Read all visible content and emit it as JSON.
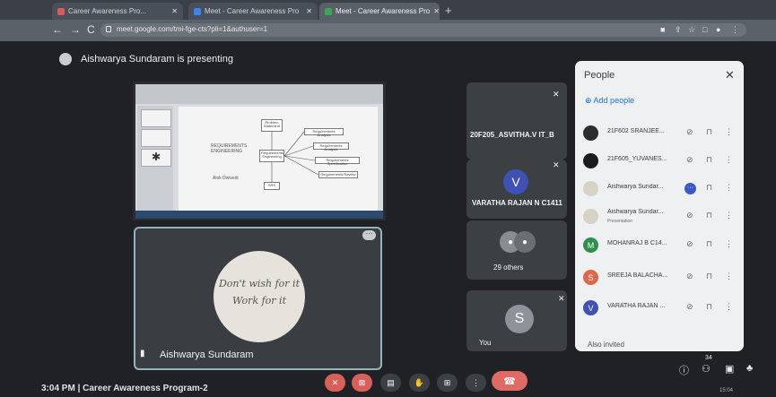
{
  "browser": {
    "tabs": [
      {
        "label": "Career Awareness Pro...",
        "icon_color": "#e0585b"
      },
      {
        "label": "Meet - Career Awareness Pro",
        "icon_color": "#3b82f6"
      },
      {
        "label": "Meet - Career Awareness Pro",
        "icon_color": "#34a853"
      }
    ],
    "url": "meet.google.com/tmi-fge-cts?pli=1&authuser=1"
  },
  "meet": {
    "presenting_text": "Aishwarya Sundaram is presenting",
    "slide": {
      "title_text": "REQUIREMENTS ENGINEERING",
      "subtitle_text": "Alok Dwivedi",
      "boxes": [
        "Problem Statement",
        "Requirements Engineering",
        "SRS",
        "Requirements Analysis",
        "Requirements Analysis",
        "Requirements Specification",
        "Requirements Review"
      ]
    },
    "self_tile": {
      "name": "Aishwarya Sundaram",
      "quote_line1": "Don't wish for it",
      "quote_line2": "Work for it"
    },
    "tiles": [
      {
        "name": "20F205_ASVITHA.V IT_B"
      },
      {
        "name": "VARATHA RAJAN N C1411",
        "initial": "V",
        "color": "#3f51b5"
      },
      {
        "name": "29 others"
      },
      {
        "name": "You",
        "initial": "S",
        "color": "#8e9399"
      }
    ],
    "people_panel": {
      "title": "People",
      "add_label": "Add people",
      "rows": [
        {
          "name": "21F602 SRANJEE...",
          "initial": "",
          "color": "#2b2d30"
        },
        {
          "name": "21F605_YUVANES...",
          "initial": "",
          "color": "#1b1c1e"
        },
        {
          "name": "Aishwarya Sundar...",
          "initial": "",
          "color": "#d6d2c6"
        },
        {
          "name": "Aishwarya Sundar...",
          "sub": "Presentation",
          "initial": "",
          "color": "#d6d2c6"
        },
        {
          "name": "MOHANRAJ B C14...",
          "initial": "M",
          "color": "#2f8f4e"
        },
        {
          "name": "SREEJA BALACHA...",
          "initial": "S",
          "color": "#e0674a"
        },
        {
          "name": "VARATHA RAJAN ...",
          "initial": "V",
          "color": "#3f51b5"
        }
      ],
      "also_invited": "Also invited"
    },
    "bottom": {
      "time_title": "3:04 PM  |  Career Awareness Program-2",
      "participant_count": "34",
      "clock": "15:04"
    }
  }
}
